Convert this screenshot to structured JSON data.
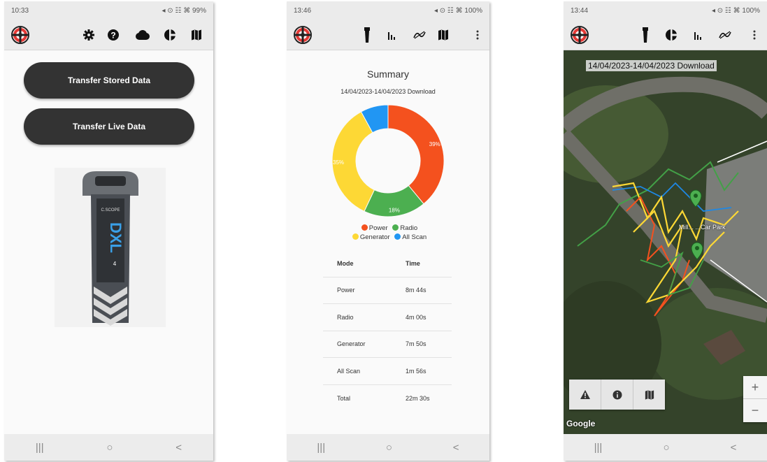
{
  "screen1": {
    "status": {
      "time": "10:33",
      "right": "◂ ⊙ ☷ ⌘ 99%"
    },
    "buttons": {
      "stored": "Transfer Stored Data",
      "live": "Transfer Live Data"
    },
    "device": {
      "brand": "C.SCOPE",
      "model": "DXL",
      "suffix": "4"
    }
  },
  "screen2": {
    "status": {
      "time": "13:46",
      "right": "◂ ⊙ ☷ ⌘ 100%"
    },
    "title": "Summary",
    "subtitle": "14/04/2023-14/04/2023 Download",
    "chart_data": {
      "type": "pie",
      "categories": [
        "Power",
        "Radio",
        "Generator",
        "All Scan"
      ],
      "values": [
        39,
        18,
        35,
        8
      ],
      "colors": [
        "#F4511E",
        "#4CAF50",
        "#FDD835",
        "#2196F3"
      ],
      "data_labels": [
        "39%",
        "18%",
        "35%",
        ""
      ],
      "legend_position": "bottom"
    },
    "legend": {
      "power": "Power",
      "radio": "Radio",
      "generator": "Generator",
      "allscan": "All Scan"
    },
    "table": {
      "headers": [
        "Mode",
        "Time"
      ],
      "rows": [
        [
          "Power",
          "8m 44s"
        ],
        [
          "Radio",
          "4m 00s"
        ],
        [
          "Generator",
          "7m 50s"
        ],
        [
          "All Scan",
          "1m 56s"
        ],
        [
          "Total",
          "22m 30s"
        ]
      ]
    }
  },
  "screen3": {
    "status": {
      "time": "13:44",
      "right": "◂ ⊙ ☷ ⌘ 100%"
    },
    "map_title": "14/04/2023-14/04/2023 Download",
    "map_label": "Mill... ...Car Park",
    "attribution": "Google",
    "zoom_in": "+",
    "zoom_out": "−"
  },
  "nav": {
    "recents": "|||",
    "home": "○",
    "back": "<"
  }
}
